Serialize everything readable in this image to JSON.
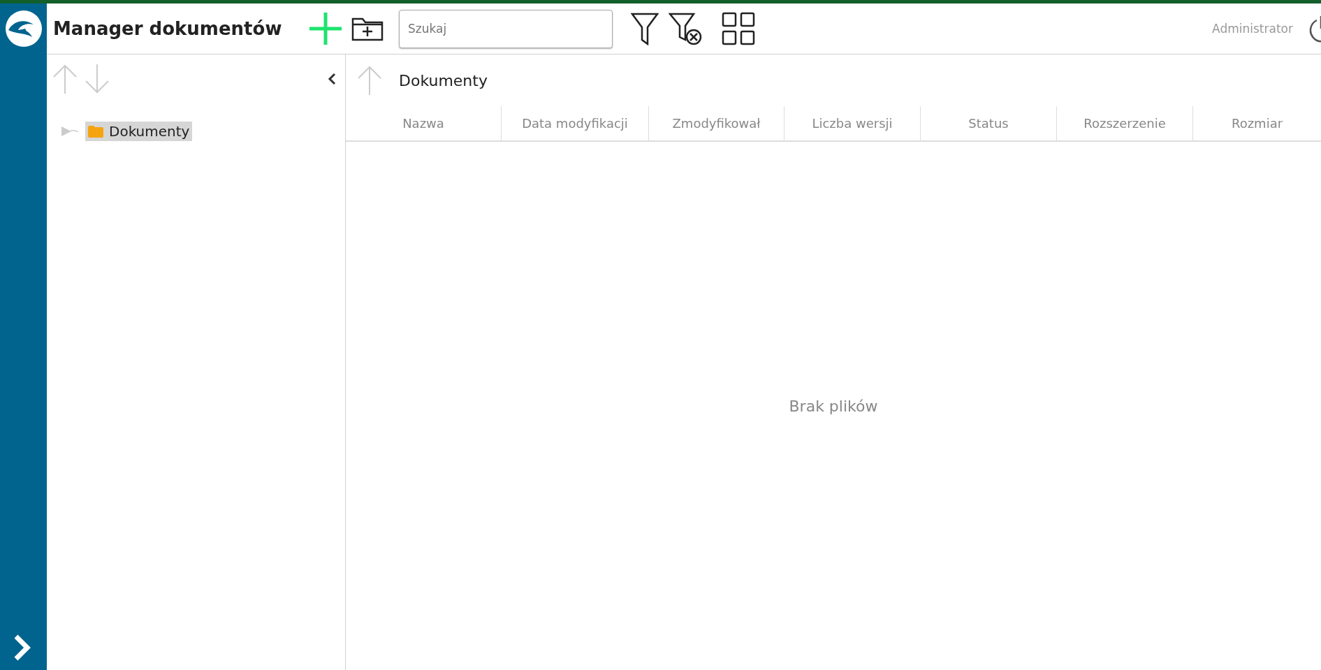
{
  "app": {
    "title": "Manager dokumentów"
  },
  "search": {
    "placeholder": "Szukaj"
  },
  "user": {
    "name": "Administrator"
  },
  "tree": [
    {
      "label": "Dokumenty",
      "selected": true,
      "expanded": false
    }
  ],
  "content": {
    "path": "Dokumenty",
    "columns": [
      "Nazwa",
      "Data modyfikacji",
      "Zmodyfikował",
      "Liczba wersji",
      "Status",
      "Rozszerzenie",
      "Rozmiar"
    ],
    "empty_message": "Brak plików"
  }
}
